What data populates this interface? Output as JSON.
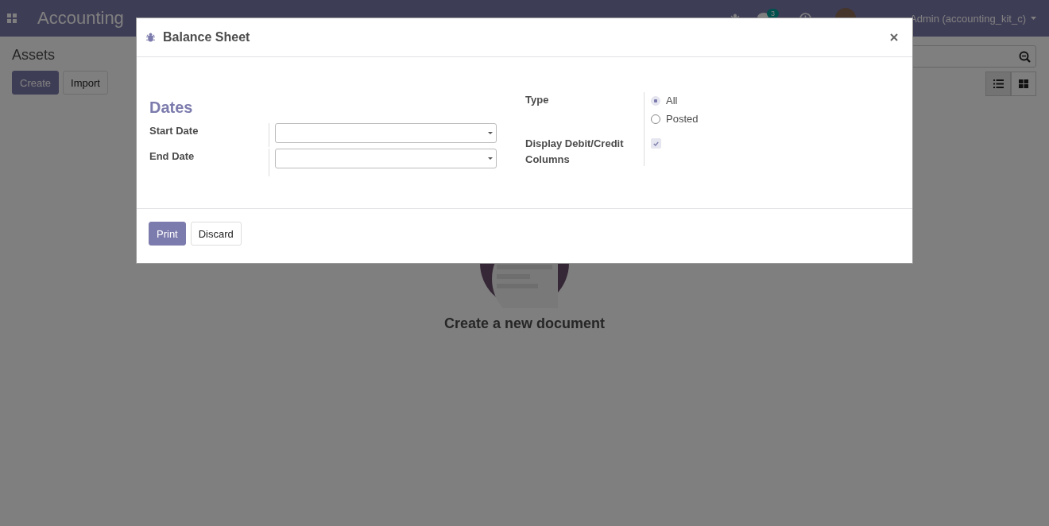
{
  "navbar": {
    "app_title": "Accounting",
    "chat_badge": "3",
    "user": "Admin (accounting_kit_c)"
  },
  "control_panel": {
    "title": "Assets",
    "buttons": [
      {
        "label": "Create",
        "kind": "primary"
      },
      {
        "label": "Import",
        "kind": "secondary"
      }
    ],
    "views": [
      {
        "kind": "list",
        "selected": true
      },
      {
        "kind": "kanban",
        "selected": false
      }
    ]
  },
  "empty_state": {
    "title": "Create a new document"
  },
  "dialog": {
    "title": "Balance Sheet",
    "section": "Dates",
    "date_fields": [
      {
        "label": "Start Date"
      },
      {
        "label": "End Date"
      }
    ],
    "type_label": "Type",
    "type_options": [
      {
        "label": "All",
        "selected": true
      },
      {
        "label": "Posted",
        "selected": false
      }
    ],
    "debit_credit": {
      "label": "Display Debit/Credit Columns",
      "checked": true
    },
    "buttons": [
      {
        "label": "Print",
        "kind": "primary"
      },
      {
        "label": "Discard",
        "kind": "secondary"
      }
    ]
  }
}
